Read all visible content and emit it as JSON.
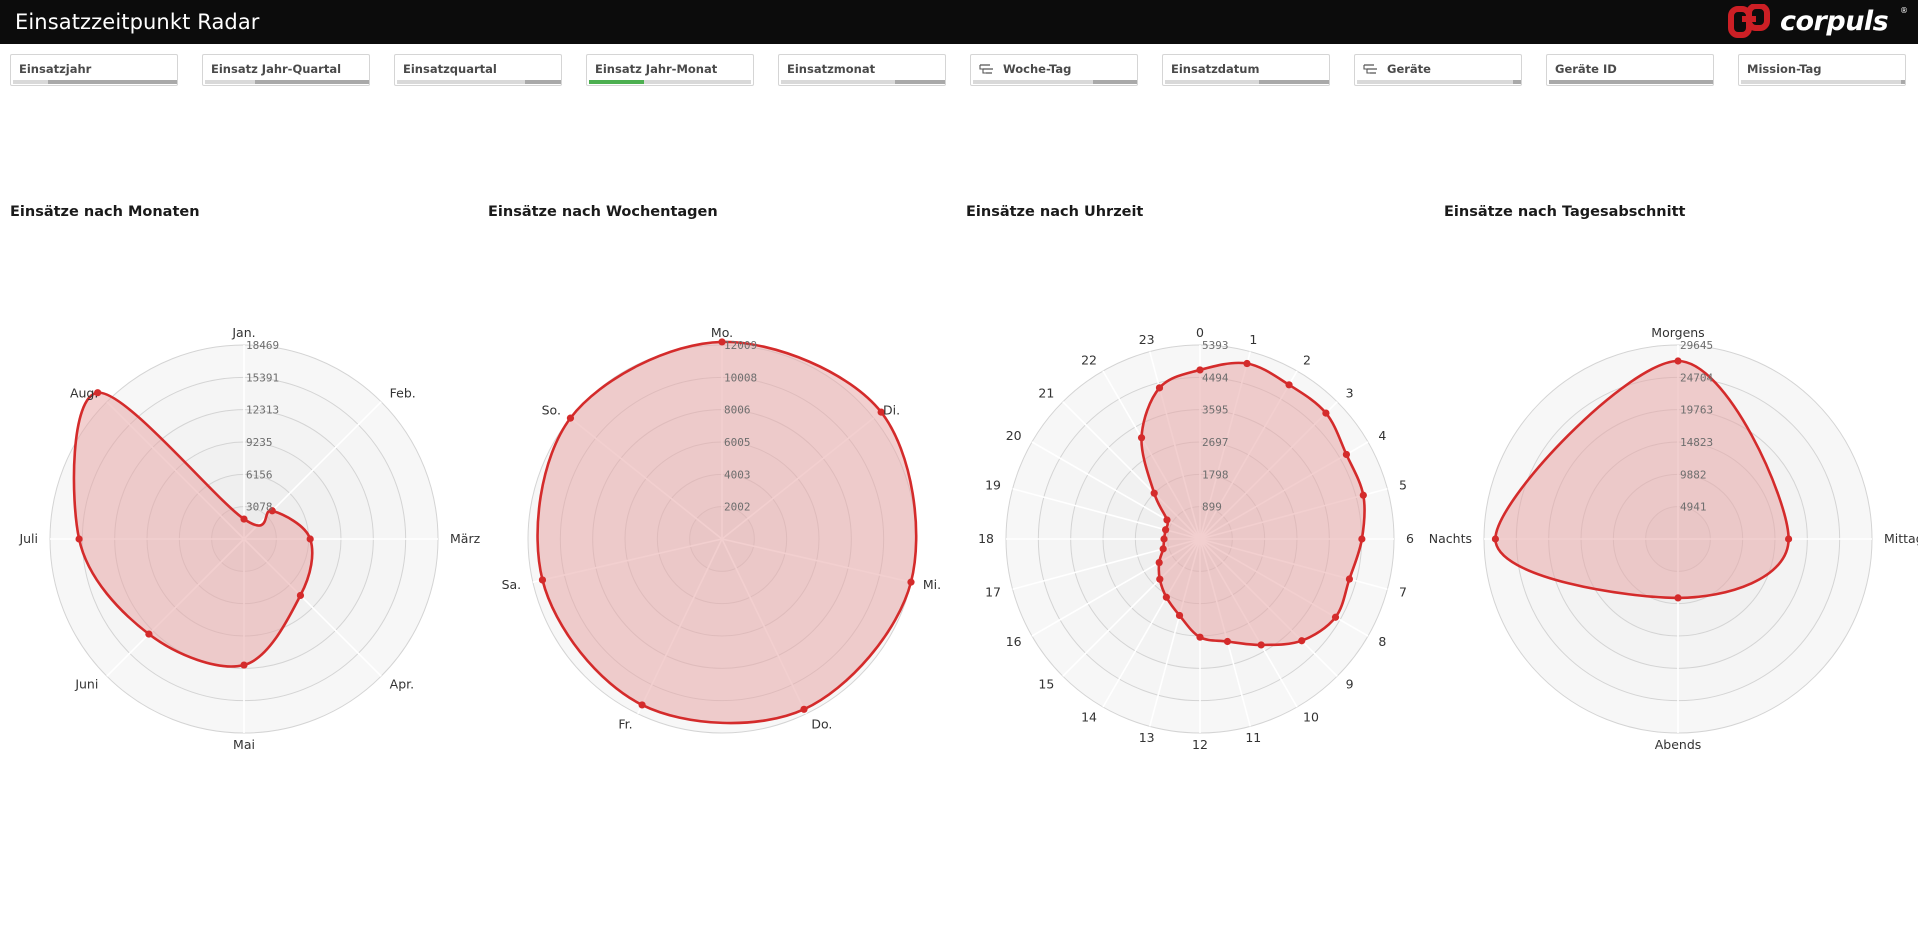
{
  "header": {
    "title": "Einsatzzeitpunkt Radar",
    "logo_text": "corpuls",
    "logo_reg": "®",
    "background": "#0c0c0c"
  },
  "filters": [
    {
      "label": "Einsatzjahr",
      "icon": null
    },
    {
      "label": "Einsatz Jahr-Quartal",
      "icon": null
    },
    {
      "label": "Einsatzquartal",
      "icon": null
    },
    {
      "label": "Einsatz Jahr-Monat",
      "icon": null
    },
    {
      "label": "Einsatzmonat",
      "icon": null
    },
    {
      "label": "Woche-Tag",
      "icon": "drill-down-icon"
    },
    {
      "label": "Einsatzdatum",
      "icon": null
    },
    {
      "label": "Geräte",
      "icon": "drill-down-icon"
    },
    {
      "label": "Geräte ID",
      "icon": null
    },
    {
      "label": "Mission-Tag",
      "icon": null
    }
  ],
  "colors": {
    "series": "#d42b2b",
    "fill": "#e8a8a8",
    "filter_selected": "#4caf50",
    "filter_bar": "#a9a9a9",
    "logo_red": "#cc1f25"
  },
  "chart_data": [
    {
      "type": "radar",
      "title": "Einsätze nach Monaten",
      "categories": [
        "Jan.",
        "Feb.",
        "März",
        "Apr.",
        "Mai",
        "Juni",
        "Juli",
        "Aug."
      ],
      "values": [
        1900,
        3800,
        6300,
        7600,
        12000,
        12800,
        15700,
        19700
      ],
      "ticks": [
        "3078",
        "6156",
        "9235",
        "12313",
        "15391",
        "18469"
      ],
      "rmax": 18469
    },
    {
      "type": "radar",
      "title": "Einsätze nach Wochentagen",
      "categories": [
        "Mo.",
        "Di.",
        "Mi.",
        "Do.",
        "Fr.",
        "Sa.",
        "So."
      ],
      "values": [
        12200,
        12600,
        12000,
        11700,
        11400,
        11400,
        12000
      ],
      "ticks": [
        "2002",
        "4003",
        "6005",
        "8006",
        "10008",
        "12009"
      ],
      "rmax": 12009
    },
    {
      "type": "radar",
      "title": "Einsätze nach Uhrzeit",
      "categories": [
        "0",
        "1",
        "2",
        "3",
        "4",
        "5",
        "6",
        "7",
        "8",
        "9",
        "10",
        "11",
        "12",
        "13",
        "14",
        "15",
        "16",
        "17",
        "18",
        "19",
        "20",
        "21",
        "22",
        "23"
      ],
      "values": [
        4700,
        5050,
        4950,
        4950,
        4700,
        4700,
        4500,
        4300,
        4350,
        4000,
        3400,
        2950,
        2730,
        2200,
        1870,
        1580,
        1310,
        1060,
        1000,
        990,
        1060,
        1800,
        3250,
        4350
      ],
      "ticks": [
        "899",
        "1798",
        "2697",
        "3595",
        "4494",
        "5393"
      ],
      "rmax": 5393
    },
    {
      "type": "radar",
      "title": "Einsätze nach Tagesabschnitt",
      "categories": [
        "Morgens",
        "Mittags",
        "Abends",
        "Nachts"
      ],
      "values": [
        27200,
        16900,
        9000,
        27900
      ],
      "ticks": [
        "4941",
        "9882",
        "14823",
        "19763",
        "24704",
        "29645"
      ],
      "rmax": 29645
    }
  ]
}
